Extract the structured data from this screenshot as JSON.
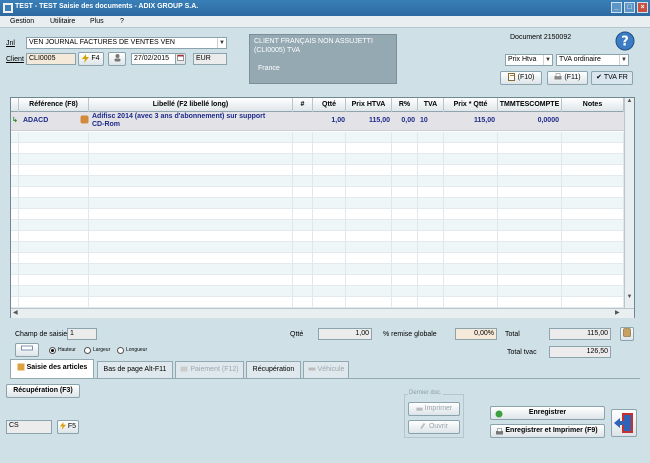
{
  "window": {
    "title": "TEST - TEST Saisie des documents - ADIX GROUP S.A.",
    "buttons": [
      "_",
      "□",
      "×"
    ]
  },
  "menu": [
    "Gestion",
    "Utilitaire",
    "Plus",
    "?"
  ],
  "header": {
    "jnl_label": "Jnl",
    "jnl_value": "VEN     JOURNAL FACTURES DE VENTES  VEN",
    "client_label": "Client",
    "client_code": "CLI0005",
    "f4_label": "F4",
    "date": "27/02/2015",
    "currency": "EUR",
    "client_info": [
      "CLIENT FRANÇAIS NON ASSUJETTI",
      "(CLI0005) TVA",
      "",
      "France"
    ],
    "document_label": "Document 2150092",
    "price_mode": "Prix Htva",
    "tva_mode": "TVA ordinaire",
    "f10_label": "(F10)",
    "f11_label": "(F11)",
    "tvafr_label": "TVA FR"
  },
  "grid": {
    "columns": [
      "Référence (F8)",
      "Libellé (F2 libellé long)",
      "#",
      "Qtté",
      "Prix HTVA",
      "R%",
      "TVA",
      "Prix * Qtté",
      "TMMTESCOMPTE",
      "Notes"
    ],
    "row": {
      "reference": "ADACD",
      "libelle_1": "Adifisc 2014 (avec 3 ans d'abonnement) sur support",
      "libelle_2": "CD-Rom",
      "qte": "1,00",
      "prix": "115,00",
      "remise": "0,00",
      "tva": "10",
      "total": "115,00",
      "tmm": "0,0000"
    }
  },
  "footer": {
    "champ_label": "Champ de saisie",
    "champ_value": "1",
    "qte_label": "Qtté",
    "qte_value": "1,00",
    "remise_label": "% remise globale",
    "remise_value": "0,00%",
    "total_label": "Total",
    "total_value": "115,00",
    "total_tvac_label": "Total tvac",
    "total_tvac_value": "126,50",
    "radio_hauteur": "Hauteur",
    "radio_largeur": "Largeur",
    "radio_longueur": "Longueur"
  },
  "tabs": [
    "Saisie des articles",
    "Bas de page Alt-F11",
    "Paiement (F12)",
    "Récupération",
    "Véhicule"
  ],
  "bottom": {
    "recuperation_btn": "Récupération (F3)",
    "dernier_doc": "Dernier doc.",
    "imprimer": "Imprimer",
    "ouvrir": "Ouvrir",
    "enregistrer": "Enregistrer",
    "enregistrer_imprimer": "Enregistrer et Imprimer (F9)",
    "cs_value": "CS",
    "f5_label": "F5"
  },
  "colors": {
    "title_bar": "#2c6aa0",
    "background": "#cfe0e6",
    "row_text": "#1d2a8a"
  }
}
